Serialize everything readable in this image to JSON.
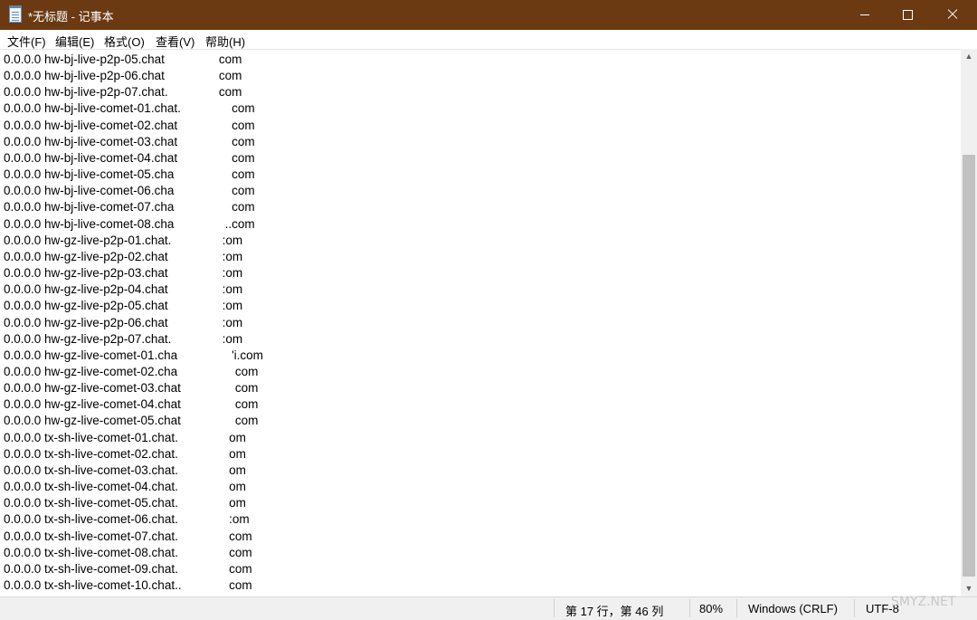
{
  "window": {
    "title": "*无标题 - 记事本",
    "icon": "notepad-icon",
    "controls": [
      "minimize-icon",
      "maximize-icon",
      "close-icon"
    ],
    "title_bar_color": "#6b3a12"
  },
  "menu": [
    {
      "label": "文件(F)"
    },
    {
      "label": "编辑(E)"
    },
    {
      "label": "格式(O)"
    },
    {
      "label": "查看(V)"
    },
    {
      "label": "帮助(H)"
    }
  ],
  "editor": {
    "lines": [
      "0.0.0.0 hw-bj-live-p2p-05.chat                com",
      "0.0.0.0 hw-bj-live-p2p-06.chat                com",
      "0.0.0.0 hw-bj-live-p2p-07.chat.               com",
      "0.0.0.0 hw-bj-live-comet-01.chat.               com",
      "0.0.0.0 hw-bj-live-comet-02.chat                com",
      "0.0.0.0 hw-bj-live-comet-03.chat                com",
      "0.0.0.0 hw-bj-live-comet-04.chat                com",
      "0.0.0.0 hw-bj-live-comet-05.cha                 com",
      "0.0.0.0 hw-bj-live-comet-06.cha                 com",
      "0.0.0.0 hw-bj-live-comet-07.cha                 com",
      "0.0.0.0 hw-bj-live-comet-08.cha               ..com",
      "0.0.0.0 hw-gz-live-p2p-01.chat.               :om",
      "0.0.0.0 hw-gz-live-p2p-02.chat                :om",
      "0.0.0.0 hw-gz-live-p2p-03.chat                :om",
      "0.0.0.0 hw-gz-live-p2p-04.chat                :om",
      "0.0.0.0 hw-gz-live-p2p-05.chat                :om",
      "0.0.0.0 hw-gz-live-p2p-06.chat                :om",
      "0.0.0.0 hw-gz-live-p2p-07.chat.               :om",
      "0.0.0.0 hw-gz-live-comet-01.cha                'i.com",
      "0.0.0.0 hw-gz-live-comet-02.cha                 com",
      "0.0.0.0 hw-gz-live-comet-03.chat                com",
      "0.0.0.0 hw-gz-live-comet-04.chat                com",
      "0.0.0.0 hw-gz-live-comet-05.chat                com",
      "0.0.0.0 tx-sh-live-comet-01.chat.               om",
      "0.0.0.0 tx-sh-live-comet-02.chat.               om",
      "0.0.0.0 tx-sh-live-comet-03.chat.               om",
      "0.0.0.0 tx-sh-live-comet-04.chat.               om",
      "0.0.0.0 tx-sh-live-comet-05.chat.               om",
      "0.0.0.0 tx-sh-live-comet-06.chat.               :om",
      "0.0.0.0 tx-sh-live-comet-07.chat.               com",
      "0.0.0.0 tx-sh-live-comet-08.chat.               com",
      "0.0.0.0 tx-sh-live-comet-09.chat.               com",
      "0.0.0.0 tx-sh-live-comet-10.chat..              com"
    ]
  },
  "scrollbar": {
    "up_arrow": "▲",
    "down_arrow": "▼",
    "position_fraction": 0.2
  },
  "status": {
    "position": "第 17 行，第 46 列",
    "zoom": "80%",
    "line_ending": "Windows (CRLF)",
    "encoding": "UTF-8"
  },
  "watermark": "SMYZ.NET"
}
